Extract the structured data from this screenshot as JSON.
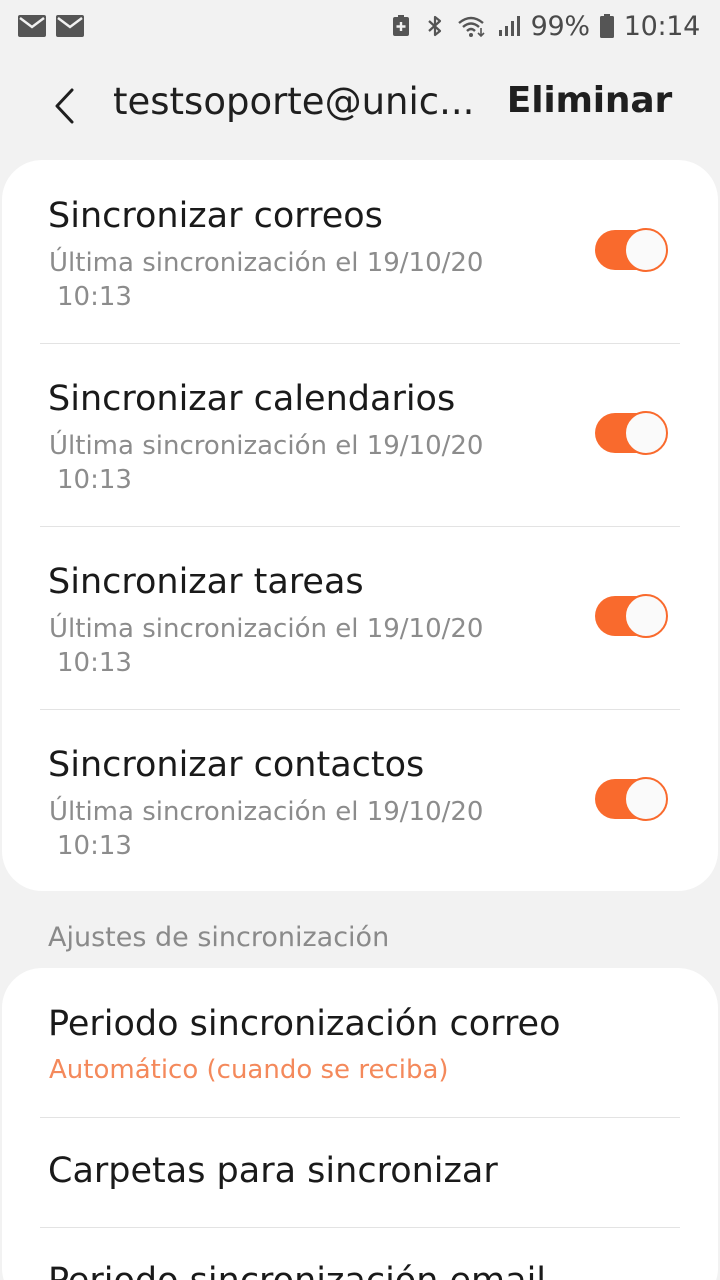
{
  "status_bar": {
    "left_icons": [
      "mail-icon",
      "mail-icon"
    ],
    "right_icons": [
      "battery-saver-icon",
      "bluetooth-icon",
      "wifi-icon",
      "signal-icon"
    ],
    "battery": "99%",
    "time": "10:14"
  },
  "app_bar": {
    "title": "testsoporte@unic...",
    "action": "Eliminar",
    "back_icon": "chevron-left-icon"
  },
  "sync_items": [
    {
      "title": "Sincronizar correos",
      "sub_line1": "Última sincronización el 19/10/20",
      "sub_line2": "10:13",
      "enabled": true
    },
    {
      "title": "Sincronizar calendarios",
      "sub_line1": "Última sincronización el 19/10/20",
      "sub_line2": "10:13",
      "enabled": true
    },
    {
      "title": "Sincronizar tareas",
      "sub_line1": "Última sincronización el 19/10/20",
      "sub_line2": "10:13",
      "enabled": true
    },
    {
      "title": "Sincronizar contactos",
      "sub_line1": "Última sincronización el 19/10/20",
      "sub_line2": "10:13",
      "enabled": true
    }
  ],
  "section_header": "Ajustes de sincronización",
  "settings_items": [
    {
      "title": "Periodo sincronización correo",
      "value": "Automático (cuando se reciba)"
    },
    {
      "title": "Carpetas para sincronizar"
    },
    {
      "title": "Periodo sincronización email"
    }
  ],
  "colors": {
    "accent": "#f96a2d",
    "value_text": "#f4895b",
    "background": "#f2f2f2",
    "card": "#ffffff"
  }
}
